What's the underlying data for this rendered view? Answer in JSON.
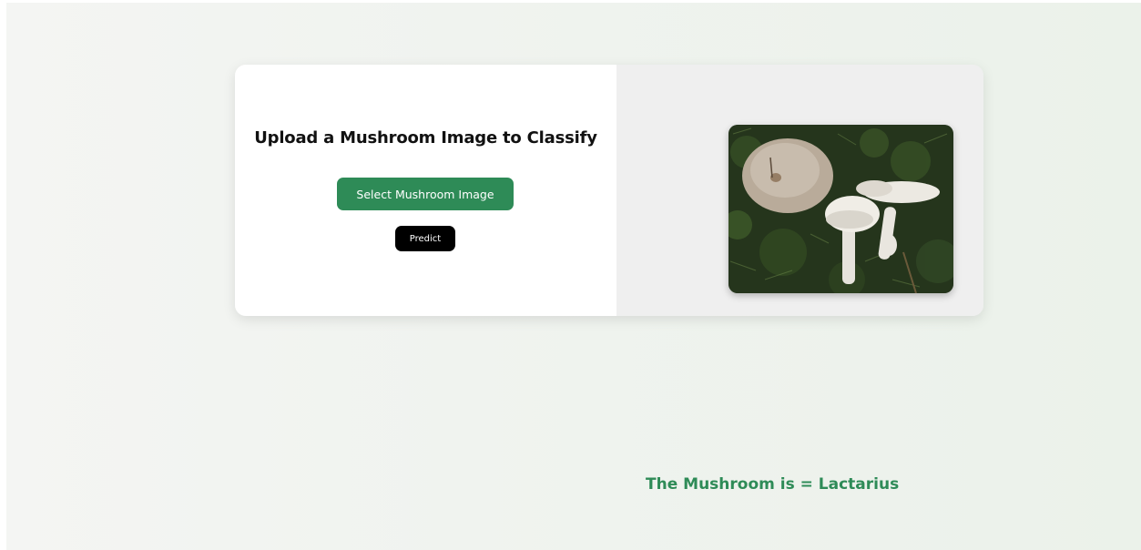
{
  "upload_panel": {
    "title": "Upload a Mushroom Image to Classify",
    "select_button_label": "Select Mushroom Image",
    "predict_button_label": "Predict"
  },
  "preview": {
    "image_alt": "Selected mushroom image"
  },
  "result": {
    "text": "The Mushroom is = Lactarius"
  },
  "colors": {
    "accent": "#2e8b57",
    "predict_button": "#000000",
    "card_left": "#ffffff",
    "card_right": "#efefef"
  }
}
